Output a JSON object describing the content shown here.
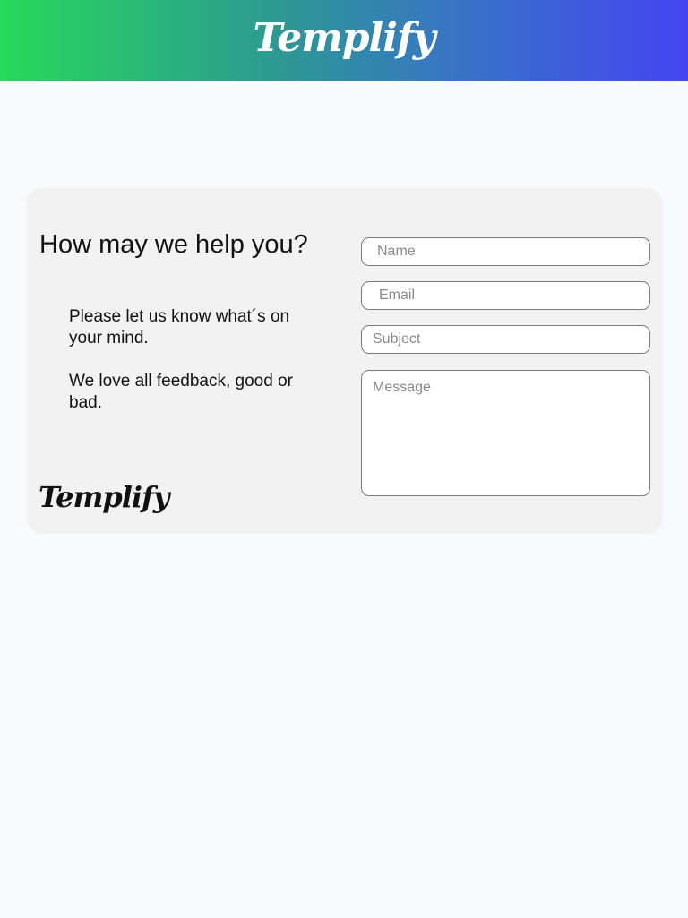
{
  "header": {
    "logo": "Templify"
  },
  "contact": {
    "heading": "How may we help you?",
    "paragraph_1": "Please let us know what´s on your mind.",
    "paragraph_2": "We love all feedback, good or bad.",
    "logo": "Templify"
  },
  "form": {
    "name_placeholder": "Name",
    "email_placeholder": "Email",
    "subject_placeholder": "Subject",
    "message_placeholder": "Message"
  },
  "colors": {
    "gradient_start": "#26d95a",
    "gradient_end": "#4446ef",
    "page_background": "#f6fcfe",
    "card_background": "#f2f2f2"
  }
}
